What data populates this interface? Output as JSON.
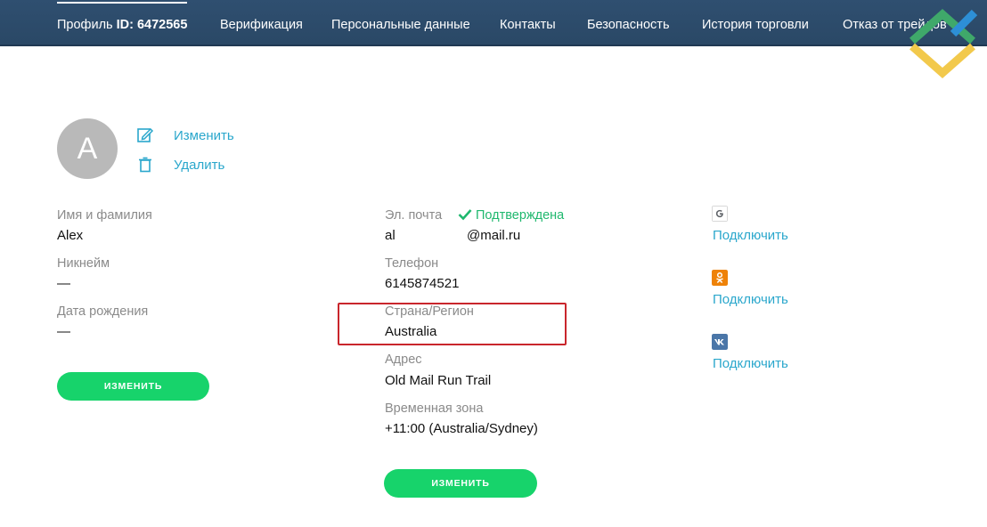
{
  "nav": {
    "items": [
      {
        "label_prefix": "Профиль ",
        "label_bold": "ID: 6472565"
      },
      {
        "label": "Верификация"
      },
      {
        "label": "Персональные данные"
      },
      {
        "label": "Контакты"
      },
      {
        "label": "Безопасность"
      },
      {
        "label": "История торговли"
      },
      {
        "label": "Отказ от трейдов"
      }
    ]
  },
  "avatar": {
    "initial": "A",
    "edit_label": "Изменить",
    "delete_label": "Удалить"
  },
  "personal": {
    "name_label": "Имя и фамилия",
    "name_value": "Alex",
    "nickname_label": "Никнейм",
    "nickname_value": "—",
    "birthdate_label": "Дата рождения",
    "birthdate_value": "—",
    "edit_button": "ИЗМЕНИТЬ"
  },
  "contact": {
    "email_label": "Эл. почта",
    "email_status": "Подтверждена",
    "email_local": "al",
    "email_domain": "@mail.ru",
    "phone_label": "Телефон",
    "phone_value": "6145874521",
    "country_label": "Страна/Регион",
    "country_value": "Australia",
    "address_label": "Адрес",
    "address_value": "Old Mail Run Trail",
    "timezone_label": "Временная зона",
    "timezone_value": "+11:00 (Australia/Sydney)",
    "edit_button": "ИЗМЕНИТЬ"
  },
  "social": [
    {
      "icon": "google-icon",
      "connect_label": "Подключить"
    },
    {
      "icon": "odnoklassniki-icon",
      "connect_label": "Подключить"
    },
    {
      "icon": "vk-icon",
      "connect_label": "Подключить"
    }
  ],
  "colors": {
    "nav_bg": "#2f4f70",
    "accent_link": "#2aa7cc",
    "button_green": "#17d36b",
    "verified_green": "#1fb86e",
    "highlight_red": "#c9262c"
  }
}
